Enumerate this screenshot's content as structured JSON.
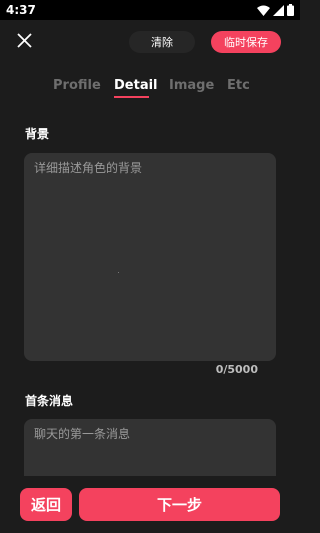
{
  "status_bar": {
    "time": "4:37",
    "icons": [
      "wifi-icon",
      "signal-icon",
      "battery-icon"
    ]
  },
  "topbar": {
    "close_icon": "close-icon",
    "clear_label": "清除",
    "temp_save_label": "临时保存"
  },
  "tabs": [
    {
      "label": "Profile",
      "active": false
    },
    {
      "label": "Detail",
      "active": true
    },
    {
      "label": "Image",
      "active": false
    },
    {
      "label": "Etc",
      "active": false
    }
  ],
  "background_section": {
    "label": "背景",
    "placeholder": "详细描述角色的背景",
    "counter": "0/5000"
  },
  "first_message_section": {
    "label": "首条消息",
    "placeholder": "聊天的第一条消息"
  },
  "bottom": {
    "back_label": "返回",
    "next_label": "下一步"
  },
  "colors": {
    "accent": "#f4425e",
    "background": "#1c1c1c",
    "field": "#333333"
  }
}
